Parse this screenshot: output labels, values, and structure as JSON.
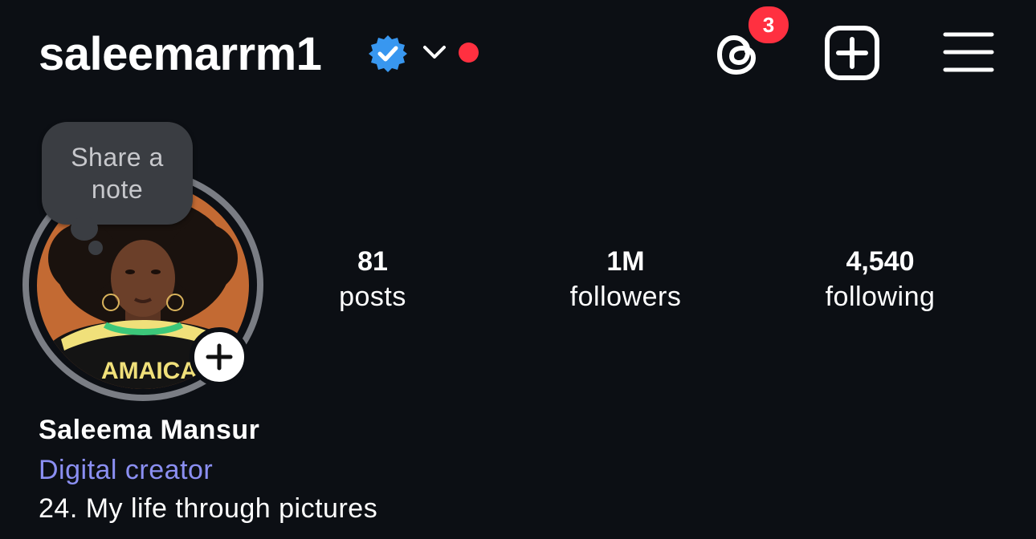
{
  "header": {
    "username": "saleemarrm1",
    "verified": true,
    "notification_count": "3",
    "icons": [
      "verified-badge-icon",
      "chevron-down-icon",
      "threads-icon",
      "new-post-icon",
      "menu-icon"
    ],
    "accent_live_dot": "#ff3040"
  },
  "avatar": {
    "note_prompt": "Share a note"
  },
  "stats": [
    {
      "value": "81",
      "label": "posts"
    },
    {
      "value": "1M",
      "label": "followers"
    },
    {
      "value": "4,540",
      "label": "following"
    }
  ],
  "bio": {
    "full_name": "Saleema Mansur",
    "category": "Digital creator",
    "text": "24. My life through pictures"
  },
  "colors": {
    "background": "#0c0f14",
    "verified_blue": "#3897f0",
    "category_link": "#8b8ff2",
    "badge_red": "#ff3040"
  }
}
